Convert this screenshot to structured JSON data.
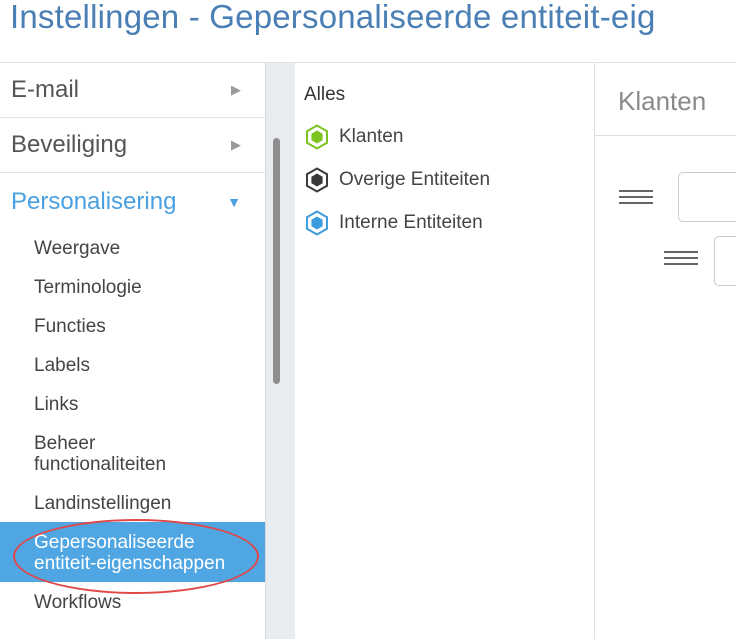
{
  "page": {
    "title": "Instellingen - Gepersonaliseerde entiteit-eig"
  },
  "sidebar": {
    "sections": [
      {
        "label": "E-mail",
        "arrow": "▶"
      },
      {
        "label": "Beveiliging",
        "arrow": "▶"
      },
      {
        "label": "Personalisering",
        "arrow": "▼"
      }
    ],
    "sub_items": [
      {
        "label": "Weergave"
      },
      {
        "label": "Terminologie"
      },
      {
        "label": "Functies"
      },
      {
        "label": "Labels"
      },
      {
        "label": "Links"
      },
      {
        "label": "Beheer\nfunctionaliteiten"
      },
      {
        "label": "Landinstellingen"
      },
      {
        "label": "Gepersonaliseerde\nentiteit-eigenschappen"
      },
      {
        "label": "Workflows"
      }
    ],
    "selected_index": 7
  },
  "entities": {
    "all_label": "Alles",
    "items": [
      {
        "label": "Klanten",
        "icon": "hexagon-green-icon",
        "color": "#7dc421"
      },
      {
        "label": "Overige Entiteiten",
        "icon": "hexagon-dark-icon",
        "color": "#3a3a3a"
      },
      {
        "label": "Interne Entiteiten",
        "icon": "hexagon-blue-icon",
        "color": "#3d9be0"
      }
    ]
  },
  "detail": {
    "title": "Klanten"
  },
  "colors": {
    "accent": "#4aa0e0",
    "selected_bg": "#4fa6e2",
    "title": "#4a7fb5",
    "highlight": "#e04848"
  }
}
